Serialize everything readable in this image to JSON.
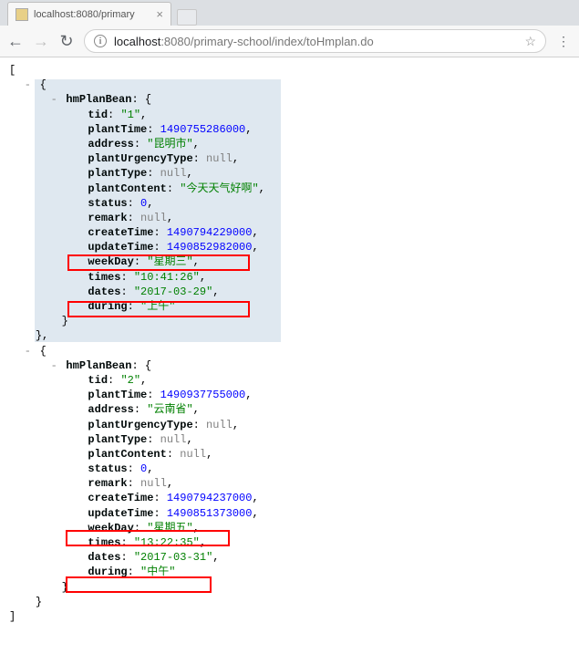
{
  "browser": {
    "tab_title": "localhost:8080/primary",
    "url_host_dim1": "localhost",
    "url_host_port": ":8080",
    "url_path": "/primary-school/index/toHmplan.do",
    "back_glyph": "←",
    "forward_glyph": "→",
    "reload_glyph": "↻",
    "info_glyph": "i",
    "star_glyph": "☆",
    "close_glyph": "×",
    "menu_glyph": "⋮"
  },
  "json_response": [
    {
      "hmPlanBean": {
        "tid": "1",
        "plantTime": 1490755286000,
        "address": "昆明市",
        "plantUrgencyType": null,
        "plantType": null,
        "plantContent": "今天天气好啊",
        "status": 0,
        "remark": null,
        "createTime": 1490794229000,
        "updateTime": 1490852982000,
        "weekDay": "星期三",
        "times": "10:41:26",
        "dates": "2017-03-29",
        "during": "上午"
      }
    },
    {
      "hmPlanBean": {
        "tid": "2",
        "plantTime": 1490937755000,
        "address": "云南省",
        "plantUrgencyType": null,
        "plantType": null,
        "plantContent": null,
        "status": 0,
        "remark": null,
        "createTime": 1490794237000,
        "updateTime": 1490851373000,
        "weekDay": "星期五",
        "times": "13:22:35",
        "dates": "2017-03-31",
        "during": "中午"
      }
    }
  ],
  "labels": {
    "hmPlanBean": "hmPlanBean",
    "tid": "tid",
    "plantTime": "plantTime",
    "address": "address",
    "plantUrgencyType": "plantUrgencyType",
    "plantType": "plantType",
    "plantContent": "plantContent",
    "status": "status",
    "remark": "remark",
    "createTime": "createTime",
    "updateTime": "updateTime",
    "weekDay": "weekDay",
    "times": "times",
    "dates": "dates",
    "during": "during",
    "null_text": "null",
    "toggle": "-"
  }
}
